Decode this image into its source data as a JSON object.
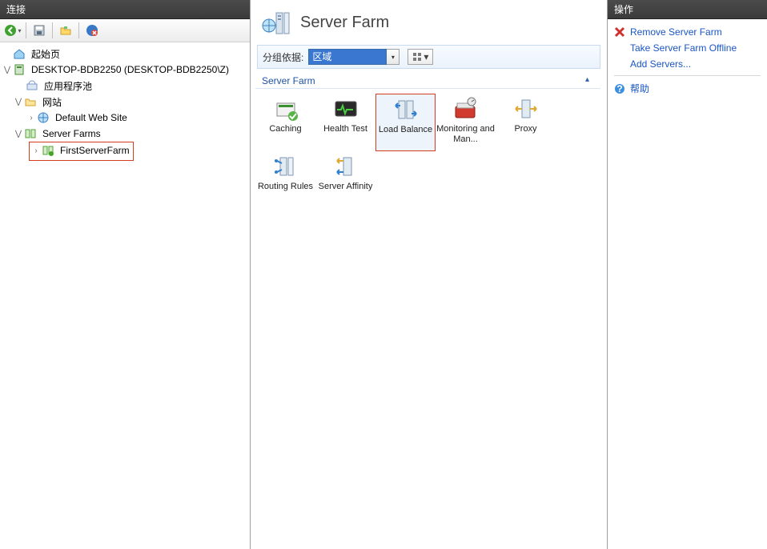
{
  "left": {
    "header": "连接",
    "toolbar": {
      "back": "back",
      "save": "save",
      "folder": "open-folder",
      "stop": "stop"
    },
    "tree": {
      "start_page": "起始页",
      "server": "DESKTOP-BDB2250 (DESKTOP-BDB2250\\Z)",
      "app_pools": "应用程序池",
      "sites": "网站",
      "default_site": "Default Web Site",
      "server_farms": "Server Farms",
      "first_farm": "FirstServerFarm"
    }
  },
  "center": {
    "title": "Server Farm",
    "group_by_label": "分组依据:",
    "group_by_value": "区域",
    "group_header": "Server Farm",
    "features": [
      {
        "id": "caching",
        "label": "Caching",
        "selected": false
      },
      {
        "id": "health-test",
        "label": "Health Test",
        "selected": false
      },
      {
        "id": "load-balance",
        "label": "Load Balance",
        "selected": true
      },
      {
        "id": "monitoring",
        "label": "Monitoring and Man...",
        "selected": false
      },
      {
        "id": "proxy",
        "label": "Proxy",
        "selected": false
      },
      {
        "id": "routing-rules",
        "label": "Routing Rules",
        "selected": false
      },
      {
        "id": "server-affinity",
        "label": "Server Affinity",
        "selected": false
      }
    ]
  },
  "right": {
    "header": "操作",
    "actions": {
      "remove": "Remove Server Farm",
      "offline": "Take Server Farm Offline",
      "add_servers": "Add Servers...",
      "help": "帮助"
    }
  }
}
